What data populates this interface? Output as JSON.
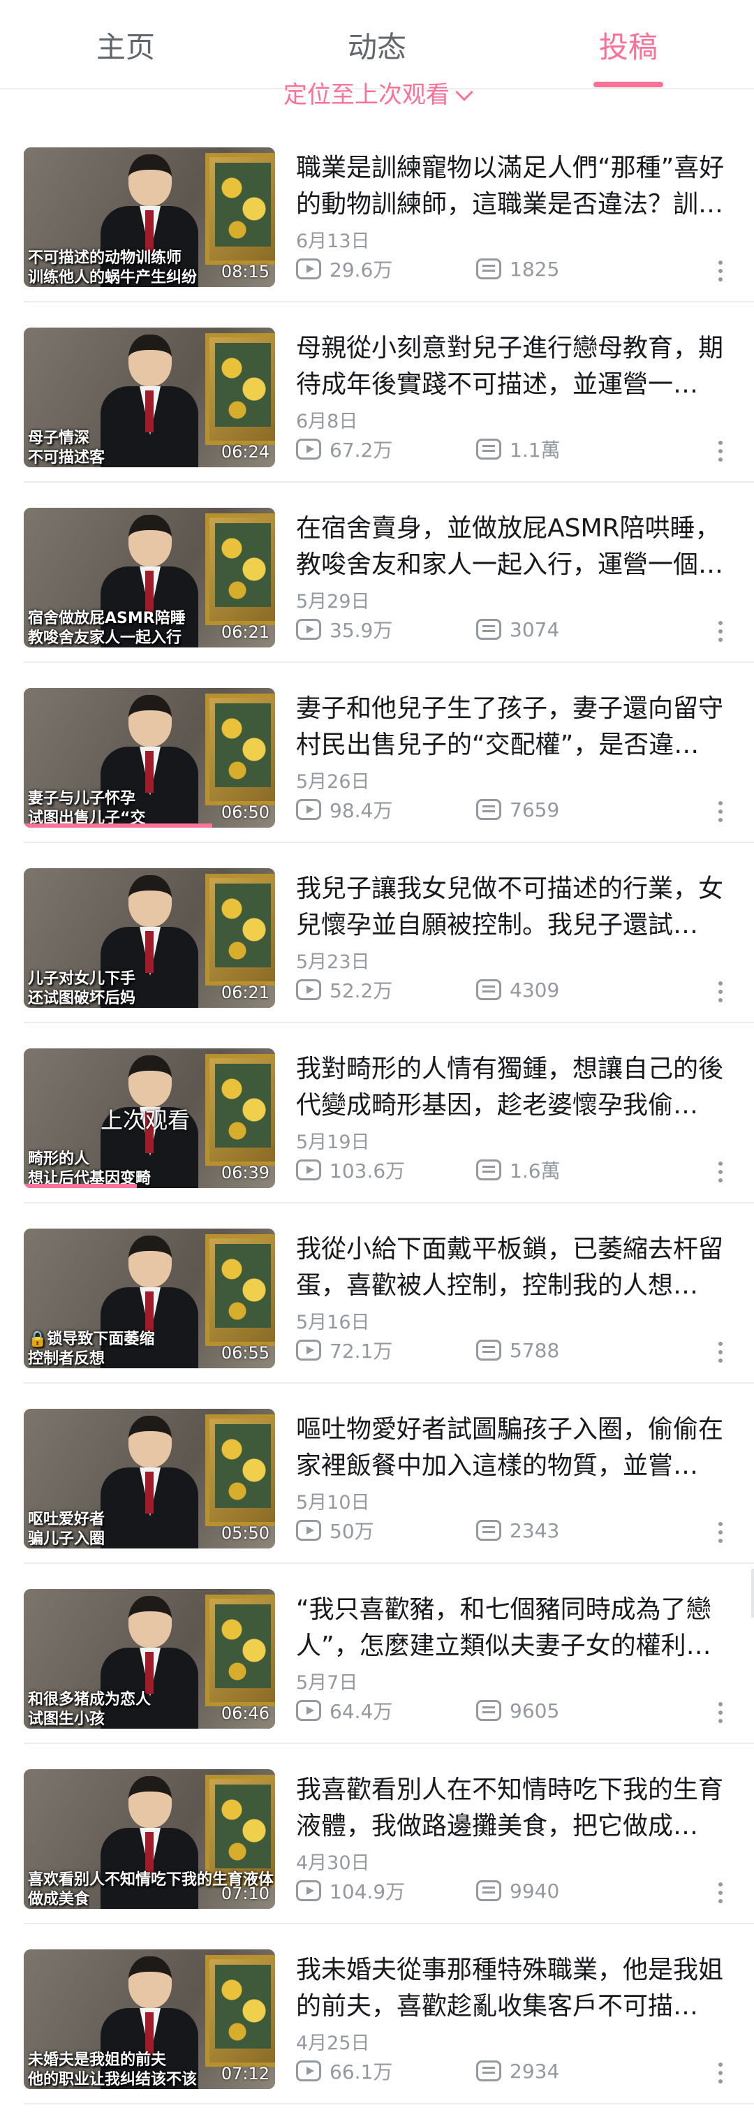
{
  "tabs": [
    "主页",
    "动态",
    "投稿"
  ],
  "active_tab_index": 2,
  "accent_color": "#fb7299",
  "locate_label": "定位至上次观看",
  "icons": {
    "views": "play-icon",
    "danmaku": "danmaku-icon",
    "more": "more-vertical-icon",
    "chevron": "chevron-down-icon"
  },
  "videos": [
    {
      "title": "職業是訓練寵物以滿足人們“那種”喜好的動物訓練師，這職業是否違法？訓…",
      "date": "6月13日",
      "views": "29.6万",
      "danmaku": "1825",
      "duration": "08:15",
      "caption1": "不可描述的动物训练师",
      "caption2": "训练他人的蜗牛产生纠纷",
      "progress": 0
    },
    {
      "title": "母親從小刻意對兒子進行戀母教育，期待成年後實踐不可描述，並運營一…",
      "date": "6月8日",
      "views": "67.2万",
      "danmaku": "1.1萬",
      "duration": "06:24",
      "caption1": "母子情深",
      "caption2": "不可描述客",
      "progress": 0
    },
    {
      "title": "在宿舍賣身，並做放屁ASMR陪哄睡，教唆舍友和家人一起入行，運營一個…",
      "date": "5月29日",
      "views": "35.9万",
      "danmaku": "3074",
      "duration": "06:21",
      "caption1": "宿舍做放屁ASMR陪睡",
      "caption2": "教唆舍友家人一起入行",
      "progress": 0
    },
    {
      "title": "妻子和他兒子生了孩子，妻子還向留守村民出售兒子的“交配權”，是否違…",
      "date": "5月26日",
      "views": "98.4万",
      "danmaku": "7659",
      "duration": "06:50",
      "caption1": "妻子与儿子怀孕",
      "caption2": "试图出售儿子“交",
      "progress": 0.75
    },
    {
      "title": "我兒子讓我女兒做不可描述的行業，女兒懷孕並自願被控制。我兒子還試…",
      "date": "5月23日",
      "views": "52.2万",
      "danmaku": "4309",
      "duration": "06:21",
      "caption1": "儿子对女儿下手",
      "caption2": "还试图破坏后妈",
      "progress": 0
    },
    {
      "title": "我對畸形的人情有獨鍾，想讓自己的後代變成畸形基因，趁老婆懷孕我偷…",
      "date": "5月19日",
      "views": "103.6万",
      "danmaku": "1.6萬",
      "duration": "06:39",
      "caption1": "畸形的人",
      "caption2": "想让后代基因变畸",
      "progress": 0.45,
      "last_watched": "上次观看"
    },
    {
      "title": "我從小給下面戴平板鎖，已萎縮去杆留蛋，喜歡被人控制，控制我的人想…",
      "date": "5月16日",
      "views": "72.1万",
      "danmaku": "5788",
      "duration": "06:55",
      "caption1": "🔒锁导致下面萎缩",
      "caption2": "控制者反想",
      "progress": 0
    },
    {
      "title": "嘔吐物愛好者試圖騙孩子入圈，偷偷在家裡飯餐中加入這樣的物質，並嘗…",
      "date": "5月10日",
      "views": "50万",
      "danmaku": "2343",
      "duration": "05:50",
      "caption1": "呕吐爱好者",
      "caption2": "骗儿子入圈",
      "progress": 0
    },
    {
      "title": "“我只喜歡豬，和七個豬同時成為了戀人”，怎麼建立類似夫妻子女的權利…",
      "date": "5月7日",
      "views": "64.4万",
      "danmaku": "9605",
      "duration": "06:46",
      "caption1": "和很多猪成为恋人",
      "caption2": "试图生小孩",
      "progress": 0
    },
    {
      "title": "我喜歡看別人在不知情時吃下我的生育液體，我做路邊攤美食，把它做成…",
      "date": "4月30日",
      "views": "104.9万",
      "danmaku": "9940",
      "duration": "07:10",
      "caption1": "喜欢看别人不知情吃下我的生育液体",
      "caption2": "做成美食",
      "progress": 0
    },
    {
      "title": "我未婚夫從事那種特殊職業，他是我姐的前夫，喜歡趁亂收集客戶不可描…",
      "date": "4月25日",
      "views": "66.1万",
      "danmaku": "2934",
      "duration": "07:12",
      "caption1": "未婚夫是我姐的前夫",
      "caption2": "他的职业让我纠结该不该",
      "progress": 0
    }
  ]
}
